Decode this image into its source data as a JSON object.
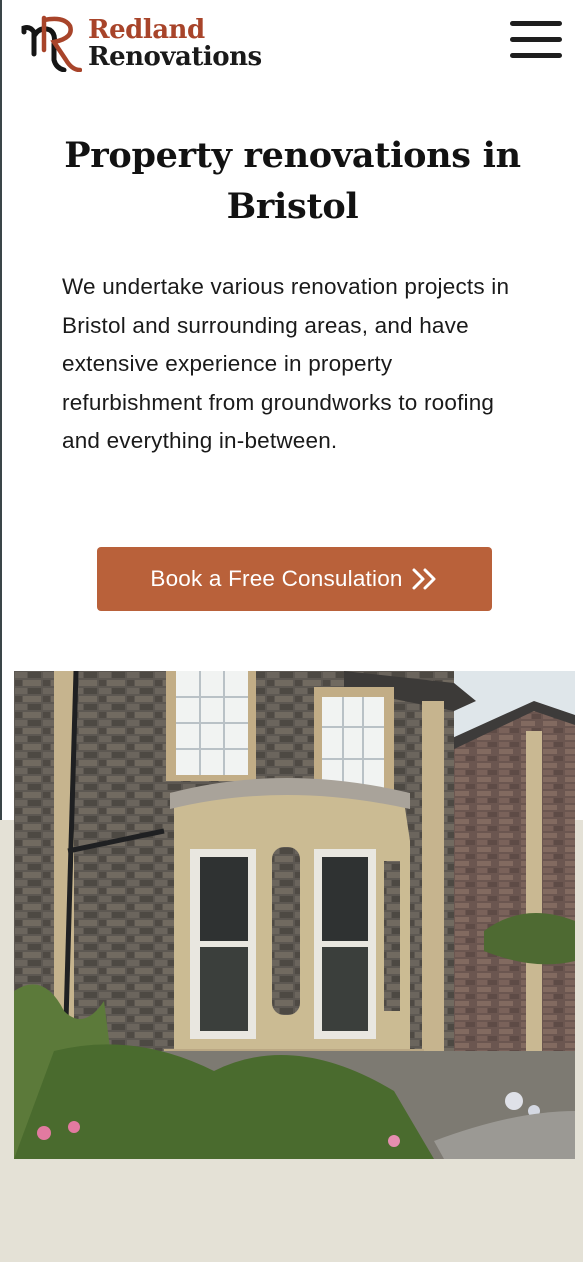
{
  "header": {
    "logo_line1": "Redland",
    "logo_line2": "Renovations",
    "logo_initials": "RR",
    "menu_icon": "hamburger-menu-icon"
  },
  "hero": {
    "title": "Property renovations in Bristol",
    "description": "We undertake various renovation projects in Bristol and surrounding areas, and have extensive experience in property refurbishment from groundworks to roofing and everything in-between.",
    "cta_label": "Book a Free Consulation",
    "cta_icon": "double-chevron-right-icon"
  },
  "colors": {
    "brand_red": "#a8442a",
    "cta": "#b9613a",
    "band": "#e4e1d6",
    "text": "#1a1a1a"
  }
}
